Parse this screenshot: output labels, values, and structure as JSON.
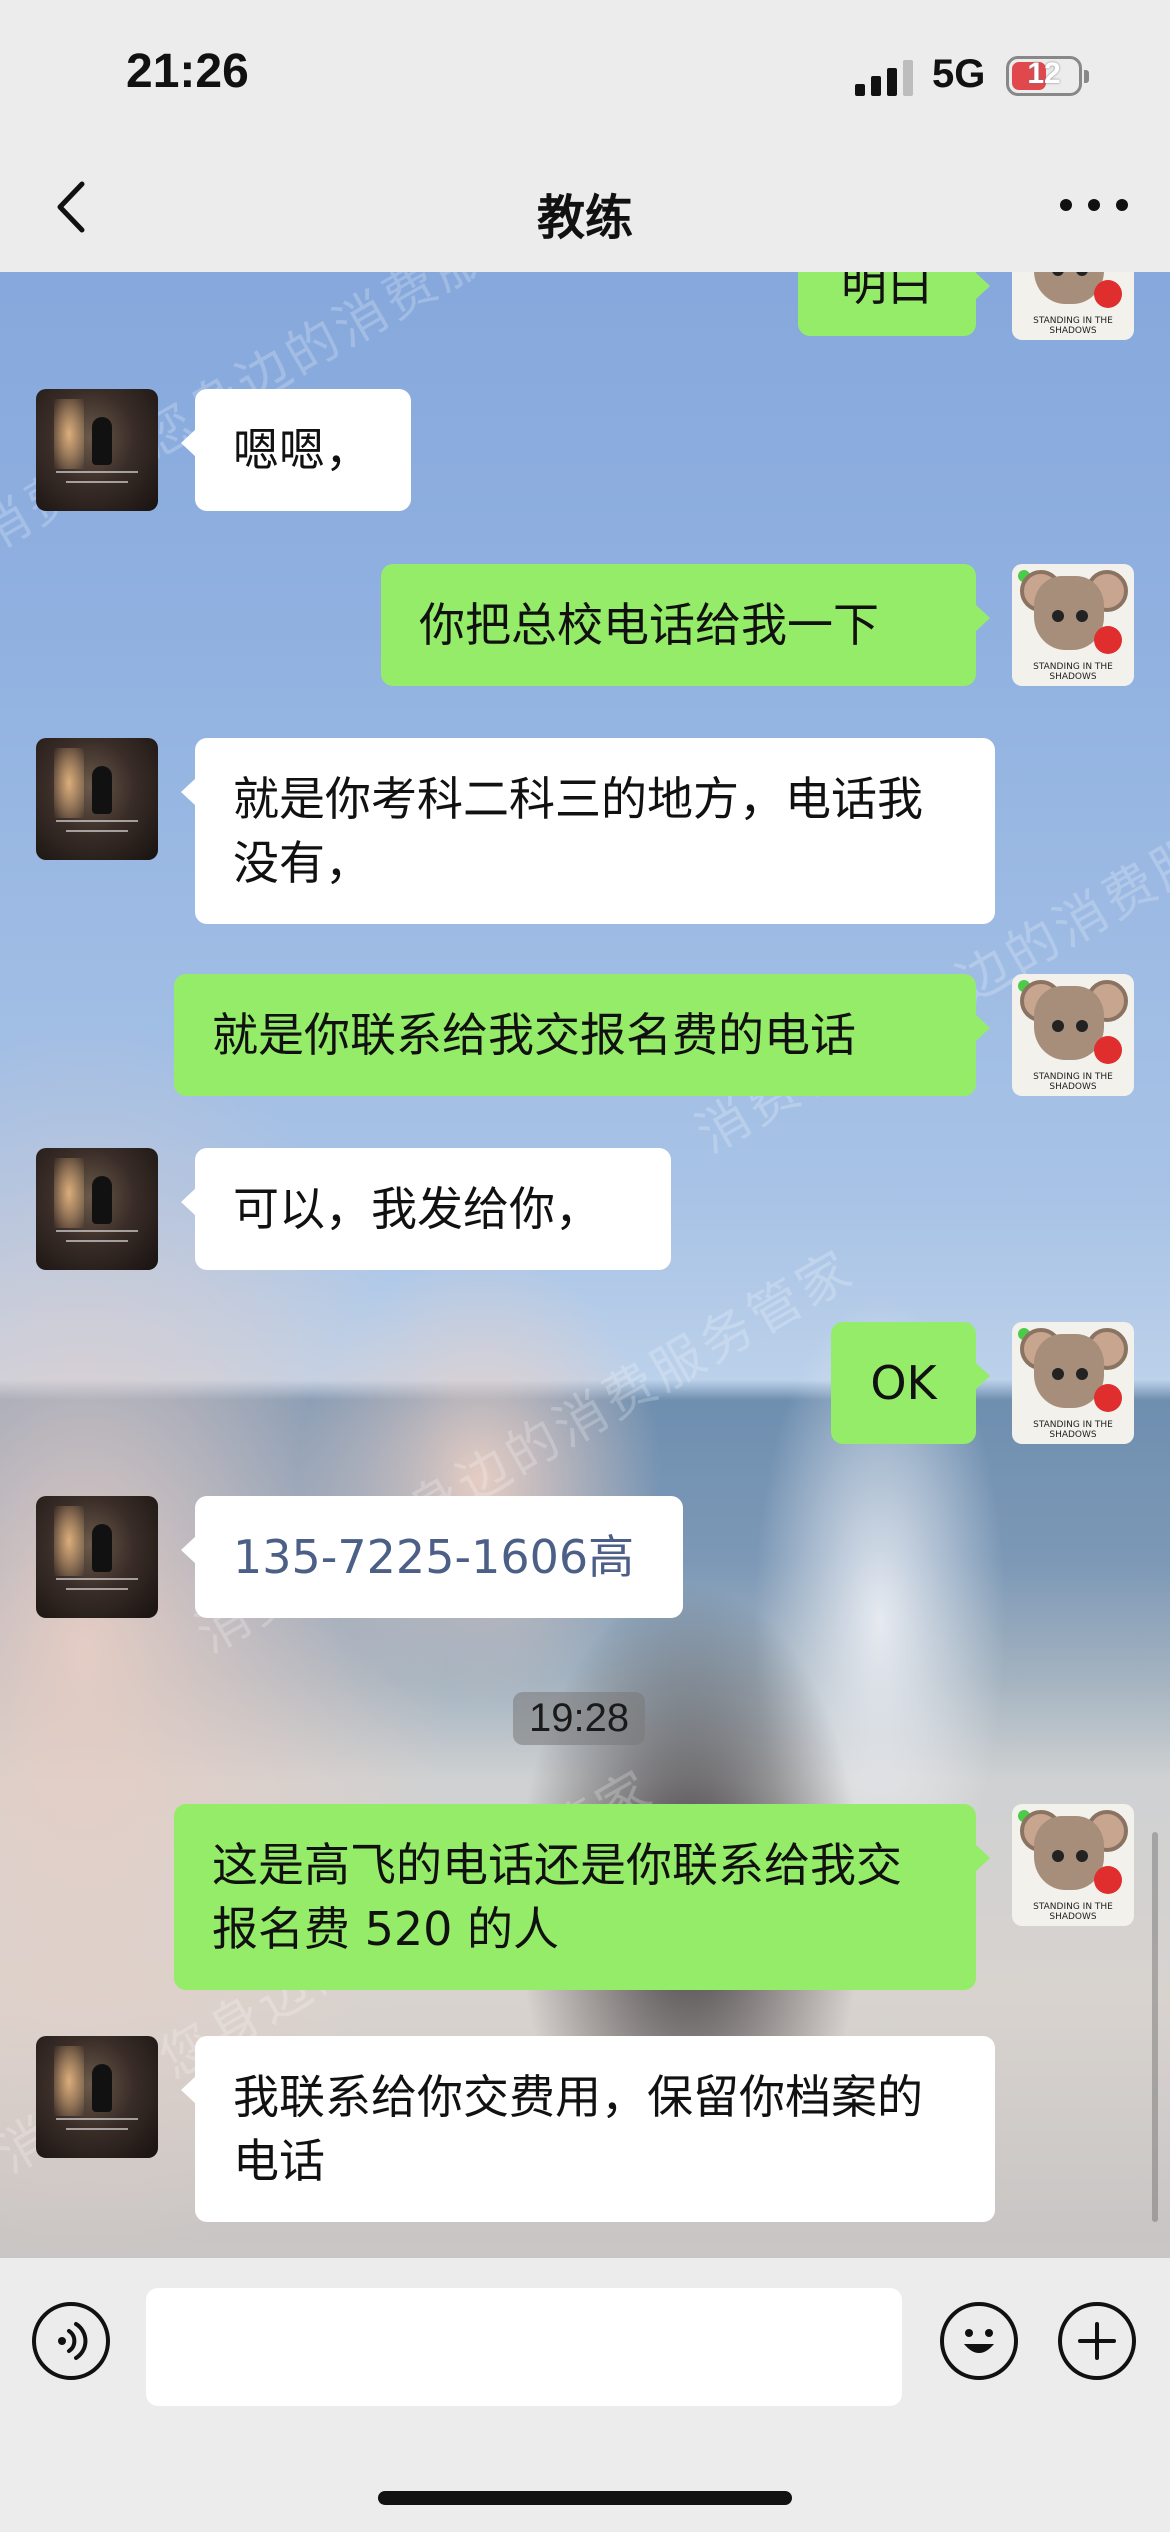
{
  "status_bar": {
    "time": "21:26",
    "network": "5G",
    "battery": "12"
  },
  "nav": {
    "title": "教练"
  },
  "watermark": "消费保 您身边的消费服务管家",
  "messages": [
    {
      "side": "out",
      "text": "明白"
    },
    {
      "side": "in",
      "text": "嗯嗯，"
    },
    {
      "side": "out",
      "text": "你把总校电话给我一下"
    },
    {
      "side": "in",
      "text": "就是你考科二科三的地方，电话我没有，"
    },
    {
      "side": "out",
      "text": "就是你联系给我交报名费的电话"
    },
    {
      "side": "in",
      "text": "可以，我发给你，"
    },
    {
      "side": "out",
      "text": "OK"
    },
    {
      "side": "in",
      "text": "135-7225-1606高",
      "is_phone": true
    },
    {
      "type": "time",
      "text": "19:28"
    },
    {
      "side": "out",
      "text": "这是高飞的电话还是你联系给我交报名费 520 的人"
    },
    {
      "side": "in",
      "text": "我联系给你交费用，保留你档案的电话"
    }
  ],
  "avatar_right_caption": "STANDING IN THE SHADOWS",
  "colors": {
    "out_bubble": "#95ec69",
    "in_bubble": "#ffffff",
    "bar_bg": "#ececec",
    "phone_text": "#4c5f87"
  },
  "icons": [
    "back-arrow-icon",
    "more-dots-icon",
    "voice-icon",
    "emoji-icon",
    "plus-icon",
    "signal-icon",
    "battery-icon"
  ]
}
